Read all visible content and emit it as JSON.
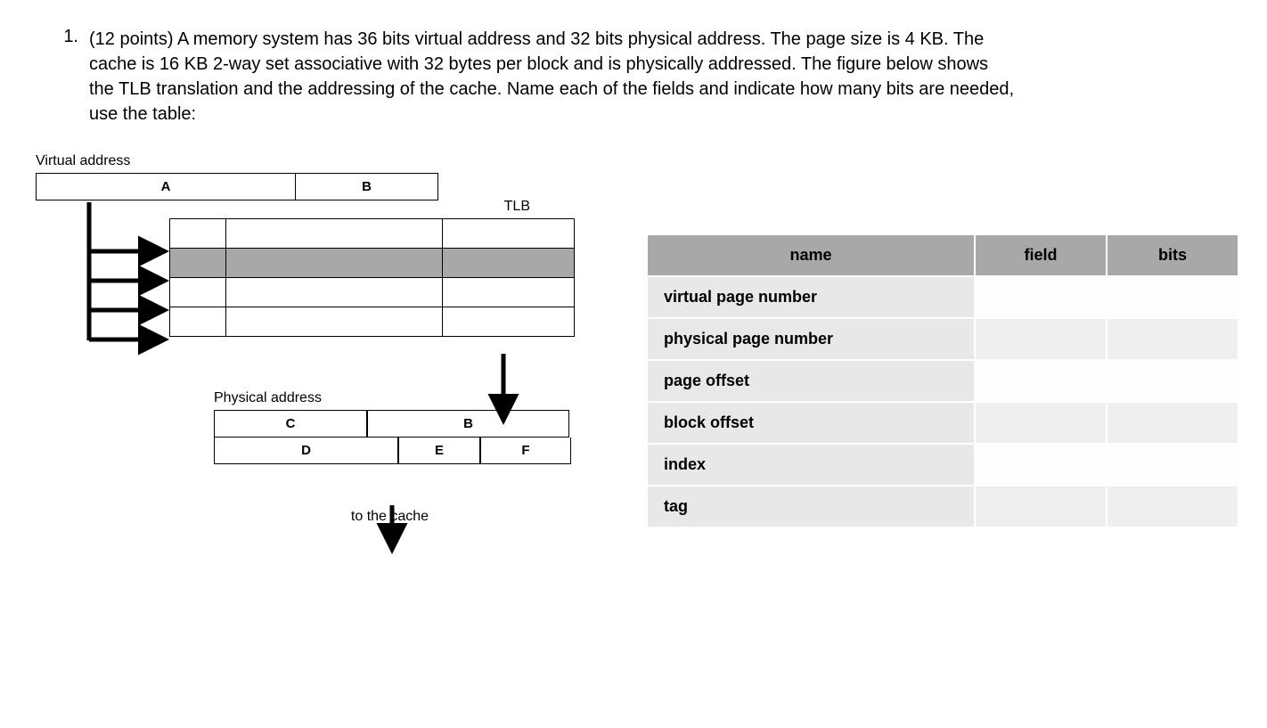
{
  "question": {
    "number": "1.",
    "text": "(12 points) A memory system has 36 bits virtual address and 32 bits physical address. The page size is 4 KB. The cache is 16 KB 2-way set associative with 32 bytes per block and is physically addressed. The figure below shows the TLB translation and the addressing of the cache. Name each of the fields and indicate how many bits are needed, use the table:"
  },
  "diagram": {
    "va_label": "Virtual address",
    "field_a": "A",
    "field_b": "B",
    "tlb_label": "TLB",
    "pa_label": "Physical address",
    "field_c": "C",
    "field_b2": "B",
    "field_d": "D",
    "field_e": "E",
    "field_f": "F",
    "to_cache": "to the cache"
  },
  "table": {
    "headers": {
      "name": "name",
      "field": "field",
      "bits": "bits"
    },
    "rows": [
      {
        "name": "virtual page number",
        "field": "",
        "bits": ""
      },
      {
        "name": "physical page number",
        "field": "",
        "bits": ""
      },
      {
        "name": "page offset",
        "field": "",
        "bits": ""
      },
      {
        "name": "block offset",
        "field": "",
        "bits": ""
      },
      {
        "name": "index",
        "field": "",
        "bits": ""
      },
      {
        "name": "tag",
        "field": "",
        "bits": ""
      }
    ]
  }
}
